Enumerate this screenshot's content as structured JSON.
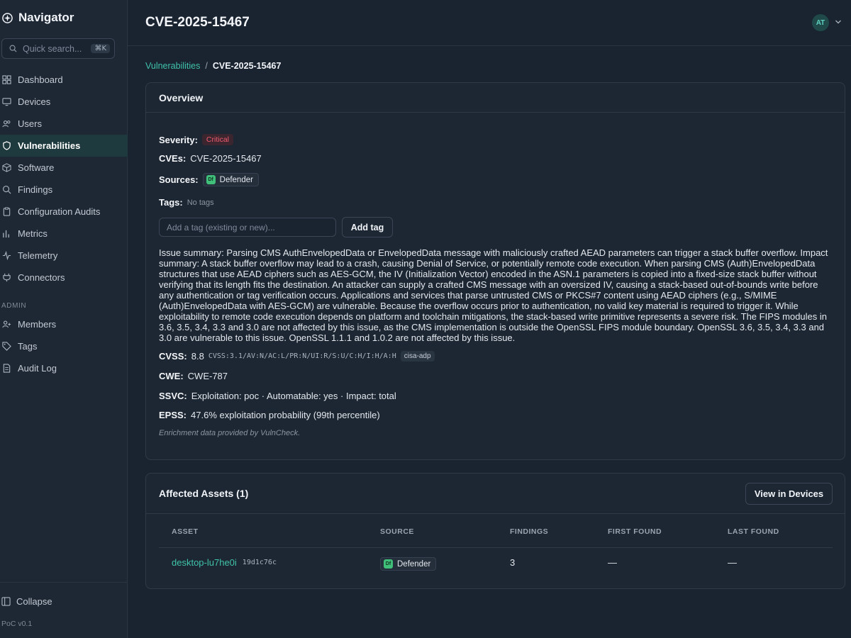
{
  "app": {
    "name": "Navigator",
    "version": "PoC v0.1"
  },
  "search": {
    "placeholder": "Quick search...",
    "shortcut": "⌘K"
  },
  "nav": {
    "items": [
      {
        "label": "Dashboard",
        "icon": "grid-icon"
      },
      {
        "label": "Devices",
        "icon": "monitor-icon"
      },
      {
        "label": "Users",
        "icon": "users-icon"
      },
      {
        "label": "Vulnerabilities",
        "icon": "shield-icon",
        "active": true
      },
      {
        "label": "Software",
        "icon": "box-icon"
      },
      {
        "label": "Findings",
        "icon": "search-icon"
      },
      {
        "label": "Configuration Audits",
        "icon": "clipboard-icon"
      },
      {
        "label": "Metrics",
        "icon": "bar-chart-icon"
      },
      {
        "label": "Telemetry",
        "icon": "activity-icon"
      },
      {
        "label": "Connectors",
        "icon": "plug-icon"
      }
    ],
    "admin_label": "ADMIN",
    "admin_items": [
      {
        "label": "Members",
        "icon": "user-plus-icon"
      },
      {
        "label": "Tags",
        "icon": "tag-icon"
      },
      {
        "label": "Audit Log",
        "icon": "file-text-icon"
      }
    ],
    "collapse_label": "Collapse"
  },
  "header": {
    "title": "CVE-2025-15467",
    "avatar_initials": "AT"
  },
  "breadcrumb": {
    "parent": "Vulnerabilities",
    "separator": "/",
    "current": "CVE-2025-15467"
  },
  "overview": {
    "title": "Overview",
    "severity_label": "Severity:",
    "severity_value": "Critical",
    "cves_label": "CVEs:",
    "cves_value": "CVE-2025-15467",
    "sources_label": "Sources:",
    "source_name": "Defender",
    "source_abbrev": "Df",
    "tags_label": "Tags:",
    "tags_value": "No tags",
    "tag_input_placeholder": "Add a tag (existing or new)...",
    "add_tag_label": "Add tag",
    "summary": "Issue summary: Parsing CMS AuthEnvelopedData or EnvelopedData message with maliciously crafted AEAD parameters can trigger a stack buffer overflow. Impact summary: A stack buffer overflow may lead to a crash, causing Denial of Service, or potentially remote code execution. When parsing CMS (Auth)EnvelopedData structures that use AEAD ciphers such as AES-GCM, the IV (Initialization Vector) encoded in the ASN.1 parameters is copied into a fixed-size stack buffer without verifying that its length fits the destination. An attacker can supply a crafted CMS message with an oversized IV, causing a stack-based out-of-bounds write before any authentication or tag verification occurs. Applications and services that parse untrusted CMS or PKCS#7 content using AEAD ciphers (e.g., S/MIME (Auth)EnvelopedData with AES-GCM) are vulnerable. Because the overflow occurs prior to authentication, no valid key material is required to trigger it. While exploitability to remote code execution depends on platform and toolchain mitigations, the stack-based write primitive represents a severe risk. The FIPS modules in 3.6, 3.5, 3.4, 3.3 and 3.0 are not affected by this issue, as the CMS implementation is outside the OpenSSL FIPS module boundary. OpenSSL 3.6, 3.5, 3.4, 3.3 and 3.0 are vulnerable to this issue. OpenSSL 1.1.1 and 1.0.2 are not affected by this issue.",
    "cvss_label": "CVSS:",
    "cvss_score": "8.8",
    "cvss_vector": "CVSS:3.1/AV:N/AC:L/PR:N/UI:R/S:U/C:H/I:H/A:H",
    "cvss_source": "cisa-adp",
    "cwe_label": "CWE:",
    "cwe_value": "CWE-787",
    "ssvc_label": "SSVC:",
    "ssvc_value": "Exploitation: poc · Automatable: yes · Impact: total",
    "epss_label": "EPSS:",
    "epss_value": "47.6% exploitation probability (99th percentile)",
    "enrichment_note": "Enrichment data provided by VulnCheck."
  },
  "assets": {
    "title": "Affected Assets (1)",
    "view_button": "View in Devices",
    "columns": [
      "ASSET",
      "SOURCE",
      "FINDINGS",
      "FIRST FOUND",
      "LAST FOUND"
    ],
    "rows": [
      {
        "asset": "desktop-lu7he0i",
        "asset_id": "19d1c76c",
        "source": "Defender",
        "source_abbrev": "Df",
        "findings": "3",
        "first_found": "—",
        "last_found": "—"
      }
    ]
  },
  "colors": {
    "accent": "#3fc3aa",
    "critical": "#f05a6e",
    "defender": "#3fbf7a"
  }
}
